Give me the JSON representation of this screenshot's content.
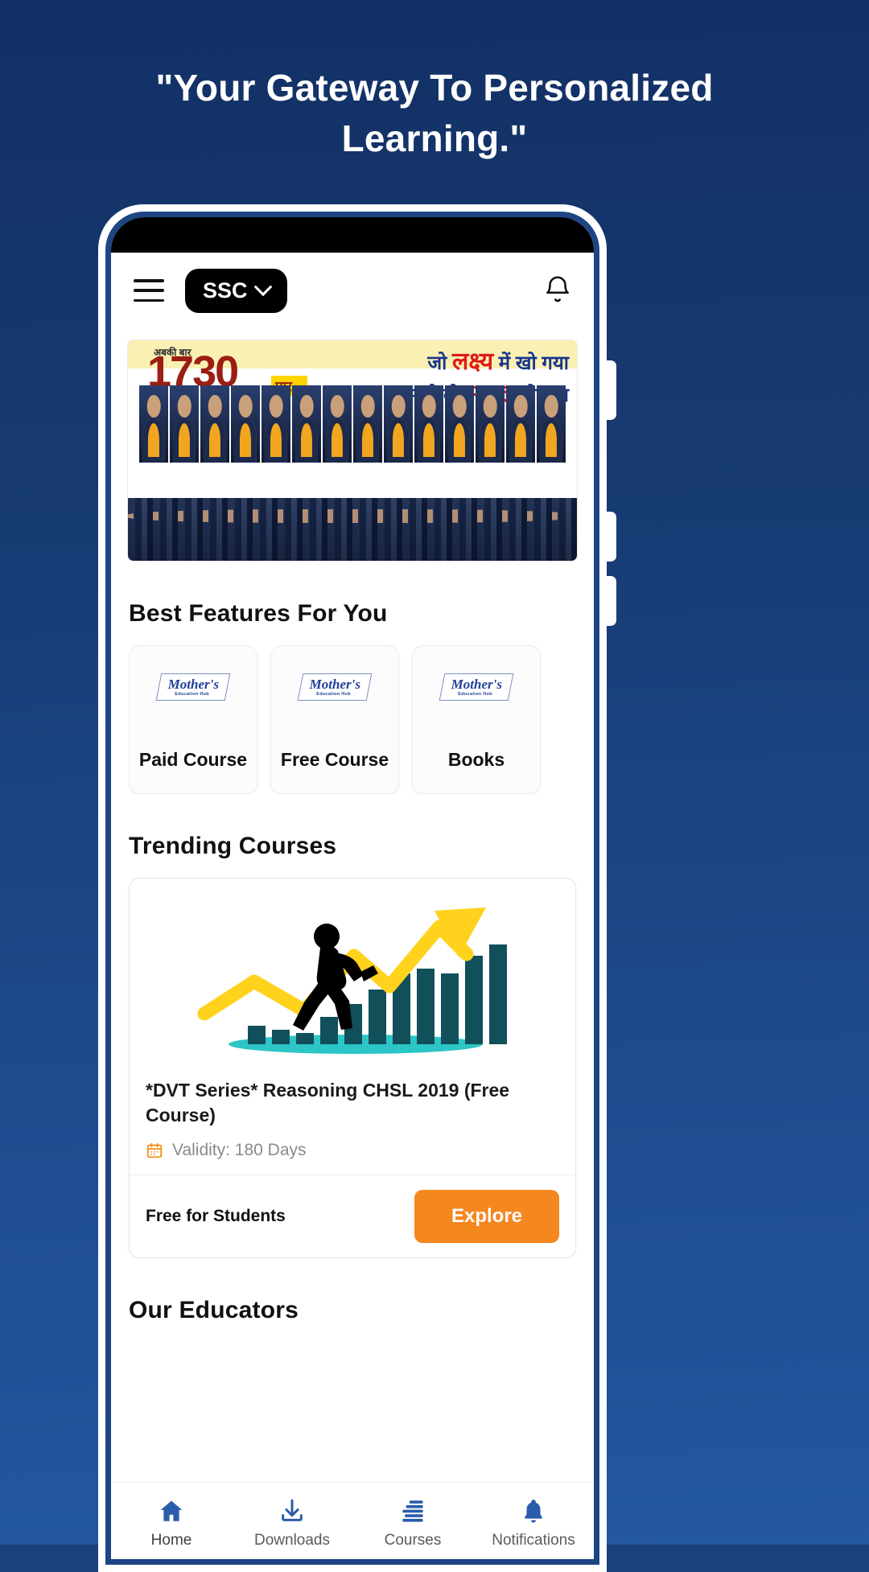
{
  "page": {
    "headline": "\"Your Gateway To Personalized Learning.\""
  },
  "colors": {
    "background_top": "#123066",
    "background_bottom": "#2357a0",
    "brand_blue": "#2b5cab",
    "accent_orange": "#f5871f",
    "chip_black": "#000000"
  },
  "header": {
    "menu_icon": "hamburger-menu-icon",
    "exam_chip_label": "SSC",
    "exam_chip_caret": "chevron-down-icon",
    "notification_icon": "bell-icon"
  },
  "banner": {
    "abki_baar": "अबकी बार",
    "number": "1730",
    "paar": "पार...",
    "line1_a": "जो ",
    "line1_b": "लक्ष्य",
    "line1_c": " में खो गया",
    "line2_a": "समझो वो ",
    "line2_b": "सफल",
    "line2_c": " हो गया"
  },
  "features": {
    "title": "Best Features For You",
    "logo": {
      "name": "Mother's",
      "tagline": "Education Hub"
    },
    "items": [
      {
        "label": "Paid Course"
      },
      {
        "label": "Free Course"
      },
      {
        "label": "Books"
      }
    ]
  },
  "trending": {
    "title": "Trending Courses",
    "course": {
      "title": "*DVT Series* Reasoning CHSL 2019 (Free Course)",
      "validity": "Validity: 180 Days",
      "validity_icon": "calendar-icon",
      "price": "Free for Students",
      "cta": "Explore"
    }
  },
  "educators": {
    "title": "Our Educators"
  },
  "bottom_nav": {
    "items": [
      {
        "label": "Home",
        "icon": "home-icon",
        "active": true
      },
      {
        "label": "Downloads",
        "icon": "download-icon",
        "active": false
      },
      {
        "label": "Courses",
        "icon": "books-stack-icon",
        "active": false
      },
      {
        "label": "Notifications",
        "icon": "bell-filled-icon",
        "active": false
      }
    ]
  }
}
